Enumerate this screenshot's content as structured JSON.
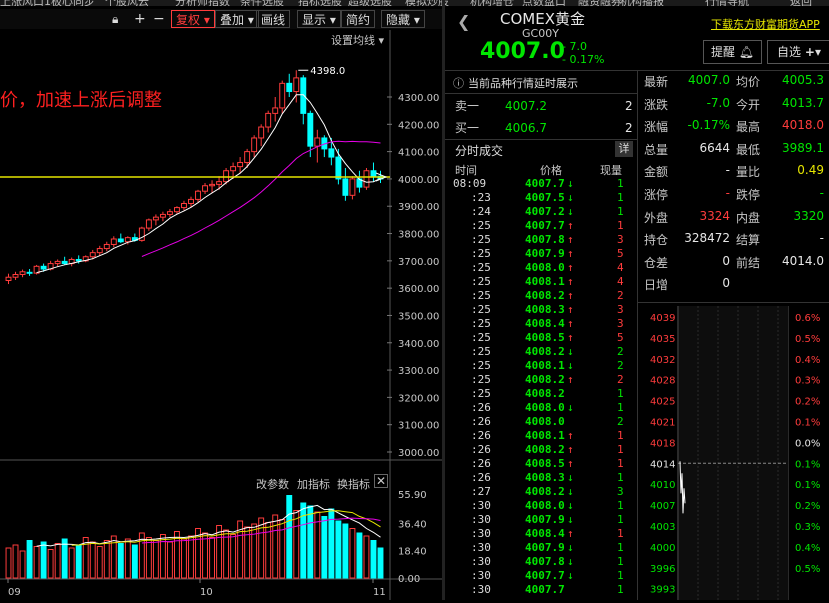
{
  "top_menu": [
    "上涨风口",
    "1板心同步",
    "个股风云",
    "分析师指数",
    "条件选股",
    "指标选股",
    "超级选股",
    "模拟炒股",
    "机构增仓",
    "点数盘口",
    "融资融券",
    "机构播报",
    "行情导航",
    "返回"
  ],
  "toolbar": {
    "add_label": "+",
    "minus_label": "−",
    "fuquan_label": "复权",
    "overlay_label": "叠加",
    "draw_label": "画线",
    "show_label": "显示",
    "simple_label": "简约",
    "hide_label": "隐藏"
  },
  "chart": {
    "settings_label": "设置均线",
    "annotation": "价，加速上涨后调整",
    "peak_label": "4398.0",
    "price_ticks": [
      "4300.00",
      "4200.00",
      "4100.00",
      "4000.00",
      "3900.00",
      "3800.00",
      "3700.00",
      "3600.00",
      "3500.00",
      "3400.00",
      "3300.00",
      "3200.00",
      "3100.00",
      "3000.00"
    ],
    "volume_tools": [
      "改参数",
      "加指标",
      "换指标"
    ],
    "volume_ticks": [
      "55.90",
      "36.40",
      "18.40",
      "0.00"
    ],
    "x_labels": [
      "09",
      "10",
      "11"
    ],
    "colors": {
      "up": "#ff3c3c",
      "down": "#00ffff",
      "ma5": "#ffffff",
      "ma10": "#e600e6",
      "ma_vol": "#e6e600",
      "ref_line": "#e6e600"
    }
  },
  "chart_data": {
    "type": "candlestick",
    "title": "COMEX黄金 GC00Y",
    "series": [
      {
        "name": "candles",
        "values": [
          [
            3628,
            3653,
            3615,
            3640
          ],
          [
            3640,
            3660,
            3630,
            3650
          ],
          [
            3650,
            3668,
            3640,
            3660
          ],
          [
            3658,
            3670,
            3645,
            3655
          ],
          [
            3655,
            3685,
            3650,
            3680
          ],
          [
            3680,
            3690,
            3660,
            3670
          ],
          [
            3670,
            3700,
            3665,
            3690
          ],
          [
            3690,
            3705,
            3680,
            3698
          ],
          [
            3698,
            3715,
            3685,
            3690
          ],
          [
            3690,
            3712,
            3680,
            3705
          ],
          [
            3705,
            3720,
            3690,
            3700
          ],
          [
            3700,
            3720,
            3695,
            3715
          ],
          [
            3715,
            3740,
            3705,
            3730
          ],
          [
            3730,
            3755,
            3720,
            3745
          ],
          [
            3745,
            3770,
            3735,
            3760
          ],
          [
            3760,
            3790,
            3750,
            3780
          ],
          [
            3780,
            3800,
            3765,
            3770
          ],
          [
            3770,
            3790,
            3760,
            3785
          ],
          [
            3785,
            3800,
            3770,
            3775
          ],
          [
            3775,
            3825,
            3770,
            3820
          ],
          [
            3820,
            3855,
            3810,
            3850
          ],
          [
            3850,
            3870,
            3830,
            3860
          ],
          [
            3860,
            3880,
            3845,
            3870
          ],
          [
            3870,
            3890,
            3860,
            3880
          ],
          [
            3880,
            3900,
            3870,
            3895
          ],
          [
            3895,
            3920,
            3885,
            3910
          ],
          [
            3910,
            3935,
            3895,
            3925
          ],
          [
            3925,
            3960,
            3915,
            3955
          ],
          [
            3955,
            3985,
            3945,
            3975
          ],
          [
            3975,
            3995,
            3950,
            3980
          ],
          [
            3980,
            4010,
            3960,
            3990
          ],
          [
            3990,
            4040,
            3980,
            4030
          ],
          [
            4030,
            4060,
            4000,
            4045
          ],
          [
            4045,
            4080,
            4020,
            4060
          ],
          [
            4060,
            4110,
            4040,
            4100
          ],
          [
            4100,
            4160,
            4080,
            4150
          ],
          [
            4150,
            4200,
            4120,
            4190
          ],
          [
            4190,
            4250,
            4170,
            4240
          ],
          [
            4240,
            4300,
            4210,
            4260
          ],
          [
            4260,
            4360,
            4240,
            4350
          ],
          [
            4350,
            4385,
            4300,
            4320
          ],
          [
            4320,
            4398,
            4280,
            4370
          ],
          [
            4370,
            4380,
            4200,
            4240
          ],
          [
            4240,
            4250,
            4080,
            4120
          ],
          [
            4120,
            4180,
            4060,
            4150
          ],
          [
            4150,
            4160,
            4080,
            4110
          ],
          [
            4110,
            4150,
            4050,
            4080
          ],
          [
            4080,
            4110,
            3980,
            4000
          ],
          [
            4000,
            4040,
            3920,
            3940
          ],
          [
            3940,
            4010,
            3925,
            4000
          ],
          [
            4000,
            4030,
            3950,
            3970
          ],
          [
            3970,
            4040,
            3960,
            4030
          ],
          [
            4030,
            4060,
            3990,
            4010
          ],
          [
            4010,
            4030,
            3985,
            4000
          ]
        ]
      },
      {
        "name": "volume",
        "values": [
          20,
          22,
          18,
          25,
          21,
          24,
          19,
          23,
          26,
          20,
          22,
          27,
          24,
          21,
          25,
          28,
          23,
          26,
          22,
          30,
          27,
          25,
          29,
          24,
          31,
          26,
          28,
          33,
          30,
          27,
          35,
          32,
          29,
          38,
          34,
          36,
          40,
          37,
          42,
          39,
          55,
          45,
          50,
          48,
          44,
          41,
          46,
          38,
          36,
          33,
          30,
          28,
          25,
          20
        ]
      }
    ],
    "ylim": [
      2950,
      4420
    ],
    "reference_line": 4007,
    "peak": 4398.0
  },
  "instrument": {
    "name": "COMEX黄金",
    "code": "GC00Y",
    "price": "4007.0",
    "change": "- 7.0",
    "change_pct": "- 0.17%",
    "download_link": "下载东方财富期货APP",
    "alert_button": "提醒",
    "watchlist_button": "自选"
  },
  "notice": "当前品种行情延时展示",
  "order_book": [
    {
      "label": "卖一",
      "price": "4007.2",
      "qty": "2"
    },
    {
      "label": "买一",
      "price": "4006.7",
      "qty": "2"
    }
  ],
  "trades_panel": {
    "title": "分时成交",
    "detail_button": "详",
    "headers": [
      "时间",
      "价格",
      "现量"
    ],
    "rows": [
      {
        "t": "08:09",
        "p": "4007.7",
        "d": "down",
        "q": "1"
      },
      {
        "t": ":23",
        "p": "4007.5",
        "d": "down",
        "q": "1"
      },
      {
        "t": ":24",
        "p": "4007.2",
        "d": "down",
        "q": "1"
      },
      {
        "t": ":25",
        "p": "4007.7",
        "d": "up",
        "q": "1"
      },
      {
        "t": ":25",
        "p": "4007.8",
        "d": "up",
        "q": "3"
      },
      {
        "t": ":25",
        "p": "4007.9",
        "d": "up",
        "q": "5"
      },
      {
        "t": ":25",
        "p": "4008.0",
        "d": "up",
        "q": "4"
      },
      {
        "t": ":25",
        "p": "4008.1",
        "d": "up",
        "q": "4"
      },
      {
        "t": ":25",
        "p": "4008.2",
        "d": "up",
        "q": "2"
      },
      {
        "t": ":25",
        "p": "4008.3",
        "d": "up",
        "q": "3"
      },
      {
        "t": ":25",
        "p": "4008.4",
        "d": "up",
        "q": "3"
      },
      {
        "t": ":25",
        "p": "4008.5",
        "d": "up",
        "q": "5"
      },
      {
        "t": ":25",
        "p": "4008.2",
        "d": "down",
        "q": "2"
      },
      {
        "t": ":25",
        "p": "4008.1",
        "d": "down",
        "q": "2"
      },
      {
        "t": ":25",
        "p": "4008.2",
        "d": "up",
        "q": "2"
      },
      {
        "t": ":25",
        "p": "4008.2",
        "d": "",
        "q": "1"
      },
      {
        "t": ":26",
        "p": "4008.0",
        "d": "down",
        "q": "1"
      },
      {
        "t": ":26",
        "p": "4008.0",
        "d": "",
        "q": "2"
      },
      {
        "t": ":26",
        "p": "4008.1",
        "d": "up",
        "q": "1"
      },
      {
        "t": ":26",
        "p": "4008.2",
        "d": "up",
        "q": "1"
      },
      {
        "t": ":26",
        "p": "4008.5",
        "d": "up",
        "q": "1"
      },
      {
        "t": ":26",
        "p": "4008.3",
        "d": "down",
        "q": "1"
      },
      {
        "t": ":27",
        "p": "4008.2",
        "d": "down",
        "q": "3"
      },
      {
        "t": ":30",
        "p": "4008.0",
        "d": "down",
        "q": "1"
      },
      {
        "t": ":30",
        "p": "4007.9",
        "d": "down",
        "q": "1"
      },
      {
        "t": ":30",
        "p": "4008.4",
        "d": "up",
        "q": "1"
      },
      {
        "t": ":30",
        "p": "4007.9",
        "d": "down",
        "q": "1"
      },
      {
        "t": ":30",
        "p": "4007.8",
        "d": "down",
        "q": "1"
      },
      {
        "t": ":30",
        "p": "4007.7",
        "d": "down",
        "q": "1"
      },
      {
        "t": ":30",
        "p": "4007.7",
        "d": "",
        "q": "1"
      }
    ]
  },
  "stats": [
    [
      {
        "l": "最新",
        "v": "4007.0",
        "c": "green"
      },
      {
        "l": "均价",
        "v": "4005.3",
        "c": "green"
      }
    ],
    [
      {
        "l": "涨跌",
        "v": "-7.0",
        "c": "green"
      },
      {
        "l": "今开",
        "v": "4013.7",
        "c": "green"
      }
    ],
    [
      {
        "l": "涨幅",
        "v": "-0.17%",
        "c": "green"
      },
      {
        "l": "最高",
        "v": "4018.0",
        "c": "red"
      }
    ],
    [
      {
        "l": "总量",
        "v": "6644",
        "c": "white"
      },
      {
        "l": "最低",
        "v": "3989.1",
        "c": "green"
      }
    ],
    [
      {
        "l": "金额",
        "v": "-",
        "c": "white"
      },
      {
        "l": "量比",
        "v": "0.49",
        "c": "yellow"
      }
    ],
    [
      {
        "l": "涨停",
        "v": "-",
        "c": "red"
      },
      {
        "l": "跌停",
        "v": "-",
        "c": "green"
      }
    ],
    [
      {
        "l": "外盘",
        "v": "3324",
        "c": "red"
      },
      {
        "l": "内盘",
        "v": "3320",
        "c": "green"
      }
    ],
    [
      {
        "l": "持仓",
        "v": "328472",
        "c": "white"
      },
      {
        "l": "结算",
        "v": "-",
        "c": "white"
      }
    ],
    [
      {
        "l": "仓差",
        "v": "0",
        "c": "white"
      },
      {
        "l": "前结",
        "v": "4014.0",
        "c": "white"
      }
    ],
    [
      {
        "l": "日增",
        "v": "0",
        "c": "white"
      },
      {
        "l": "",
        "v": "",
        "c": "white"
      }
    ]
  ],
  "mini_chart": {
    "left_ticks": [
      {
        "v": "4039",
        "c": "red"
      },
      {
        "v": "4035",
        "c": "red"
      },
      {
        "v": "4032",
        "c": "red"
      },
      {
        "v": "4028",
        "c": "red"
      },
      {
        "v": "4025",
        "c": "red"
      },
      {
        "v": "4021",
        "c": "red"
      },
      {
        "v": "4018",
        "c": "red"
      },
      {
        "v": "4014",
        "c": "white"
      },
      {
        "v": "4010",
        "c": "green"
      },
      {
        "v": "4007",
        "c": "green"
      },
      {
        "v": "4003",
        "c": "green"
      },
      {
        "v": "4000",
        "c": "green"
      },
      {
        "v": "3996",
        "c": "green"
      },
      {
        "v": "3993",
        "c": "green"
      }
    ],
    "right_ticks": [
      {
        "v": "0.6%",
        "c": "red"
      },
      {
        "v": "0.5%",
        "c": "red"
      },
      {
        "v": "0.4%",
        "c": "red"
      },
      {
        "v": "0.3%",
        "c": "red"
      },
      {
        "v": "0.2%",
        "c": "red"
      },
      {
        "v": "0.1%",
        "c": "red"
      },
      {
        "v": "0.0%",
        "c": "white"
      },
      {
        "v": "0.1%",
        "c": "green"
      },
      {
        "v": "0.1%",
        "c": "green"
      },
      {
        "v": "0.2%",
        "c": "green"
      },
      {
        "v": "0.3%",
        "c": "green"
      },
      {
        "v": "0.4%",
        "c": "green"
      },
      {
        "v": "0.5%",
        "c": "green"
      }
    ]
  }
}
